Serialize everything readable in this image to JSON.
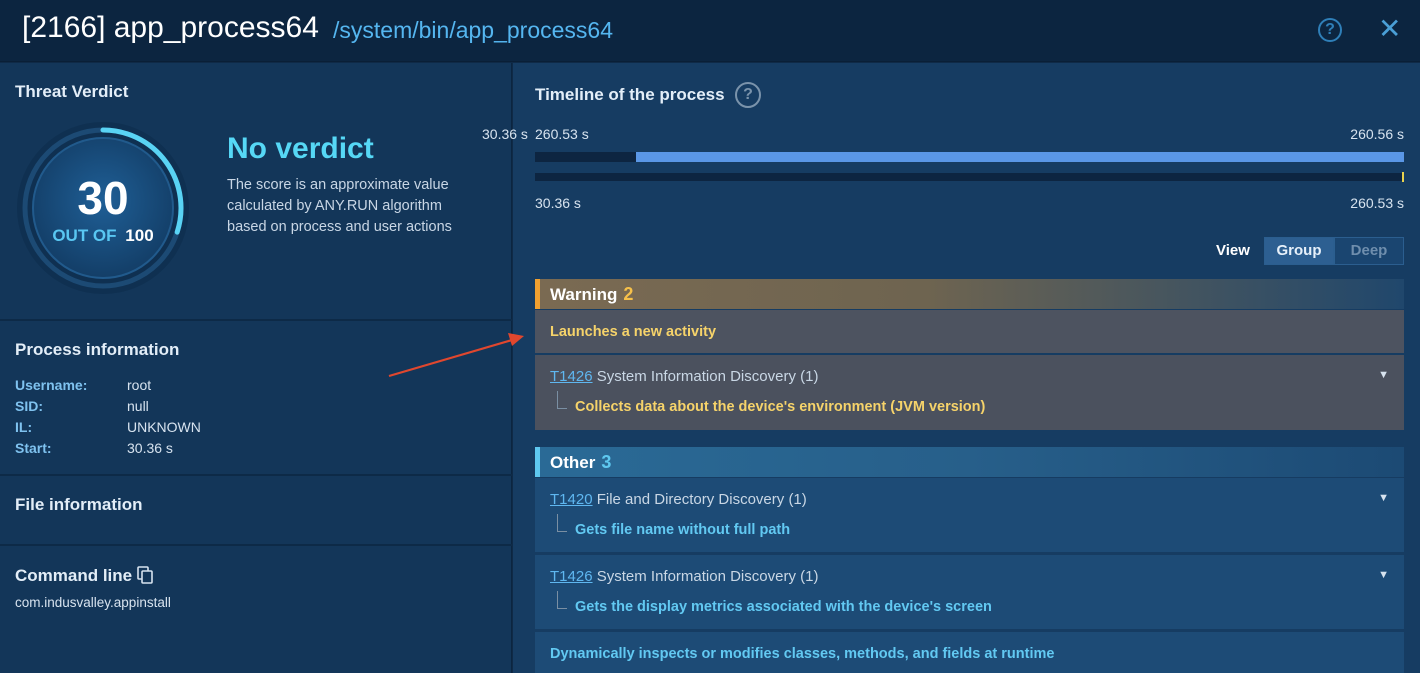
{
  "header": {
    "title": "[2166] app_process64",
    "path": "/system/bin/app_process64"
  },
  "verdict": {
    "section_title": "Threat Verdict",
    "score": "30",
    "out_of_prefix": "OUT OF",
    "out_of_value": "100",
    "score_fraction": 0.3,
    "title": "No verdict",
    "description": "The score is an approximate value calculated by ANY.RUN algorithm based on process and user actions"
  },
  "process_info": {
    "title": "Process information",
    "fields": [
      {
        "key": "Username:",
        "value": "root"
      },
      {
        "key": "SID:",
        "value": "null"
      },
      {
        "key": "IL:",
        "value": "UNKNOWN"
      },
      {
        "key": "Start:",
        "value": "30.36 s"
      }
    ]
  },
  "file_info": {
    "title": "File information"
  },
  "command_line": {
    "title": "Command line",
    "value": "com.indusvalley.appinstall"
  },
  "timeline": {
    "title": "Timeline of the process",
    "top_left_a": "30.36 s",
    "top_left_b": "260.53 s",
    "top_right": "260.56 s",
    "bottom_left": "30.36 s",
    "bottom_right": "260.53 s"
  },
  "view": {
    "label": "View",
    "options": [
      "Group",
      "Deep"
    ],
    "selected": "Group"
  },
  "groups": {
    "warning": {
      "name": "Warning",
      "count": "2",
      "color": "#f0a030",
      "items": {
        "simple": "Launches a new activity",
        "technique": {
          "id": "T1426",
          "name": "System Information Discovery (1)",
          "detail": "Collects data about the device's environment (JVM version)"
        }
      }
    },
    "other": {
      "name": "Other",
      "count": "3",
      "color": "#5ec8f0",
      "items": [
        {
          "id": "T1420",
          "name": "File and Directory Discovery (1)",
          "detail": "Gets file name without full path"
        },
        {
          "id": "T1426",
          "name": "System Information Discovery (1)",
          "detail": "Gets the display metrics associated with the device's screen"
        }
      ],
      "simple": "Dynamically inspects or modifies classes, methods, and fields at runtime"
    }
  }
}
